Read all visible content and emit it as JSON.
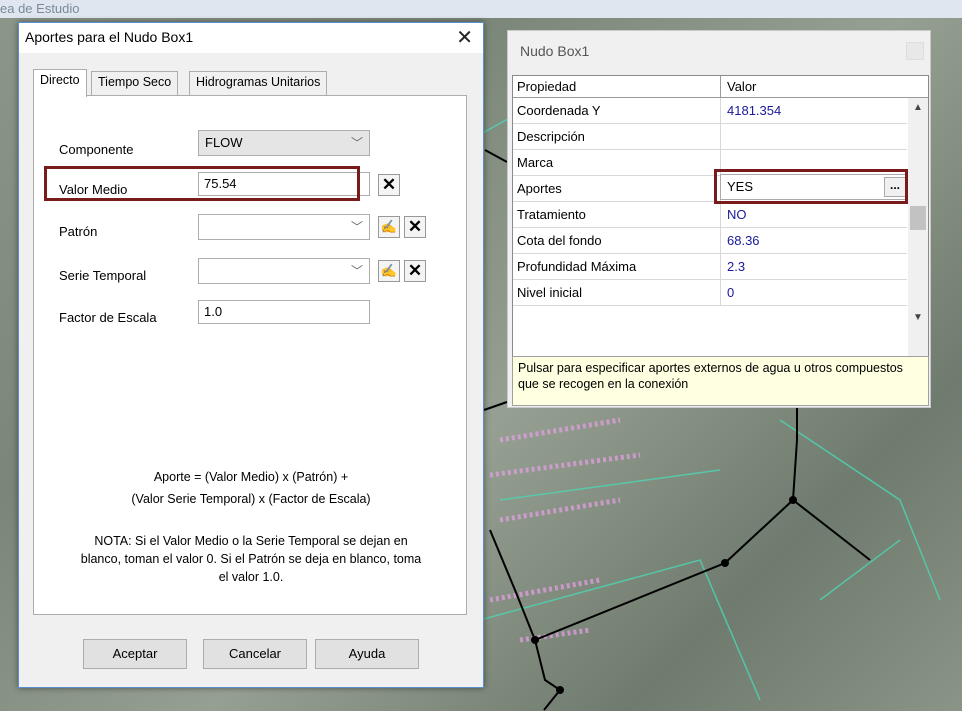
{
  "background": {
    "title_fragment": "ea de Estudio"
  },
  "dialog": {
    "title": "Aportes para el Nudo Box1",
    "close": "✕",
    "tabs": [
      "Directo",
      "Tiempo Seco",
      "Hidrogramas Unitarios"
    ],
    "componente_label": "Componente",
    "componente_value": "FLOW",
    "valor_medio_label": "Valor Medio",
    "valor_medio_value": "75.54",
    "patron_label": "Patrón",
    "patron_value": "",
    "serie_label": "Serie Temporal",
    "serie_value": "",
    "factor_label": "Factor de Escala",
    "factor_value": "1.0",
    "formula_line1": "Aporte = (Valor Medio) x (Patrón) +",
    "formula_line2": "(Valor Serie Temporal) x (Factor de Escala)",
    "note_line1": "NOTA: Si el Valor Medio o la Serie Temporal se dejan en",
    "note_line2": "blanco, toman el valor 0. Si el Patrón se deja en blanco, toma",
    "note_line3": "el valor 1.0.",
    "buttons": {
      "ok": "Aceptar",
      "cancel": "Cancelar",
      "help": "Ayuda"
    }
  },
  "properties": {
    "title": "Nudo Box1",
    "col_property": "Propiedad",
    "col_value": "Valor",
    "rows": [
      {
        "name": "Coordenada Y",
        "value": "4181.354"
      },
      {
        "name": "Descripción",
        "value": ""
      },
      {
        "name": "Marca",
        "value": ""
      },
      {
        "name": "Aportes",
        "value": "YES"
      },
      {
        "name": "Tratamiento",
        "value": "NO"
      },
      {
        "name": "Cota del fondo",
        "value": "68.36"
      },
      {
        "name": "Profundidad Máxima",
        "value": "2.3"
      },
      {
        "name": "Nivel inicial",
        "value": "0"
      }
    ],
    "ellipsis": "...",
    "description": "Pulsar para especificar aportes externos de agua u otros compuestos que se recogen en la conexión"
  }
}
